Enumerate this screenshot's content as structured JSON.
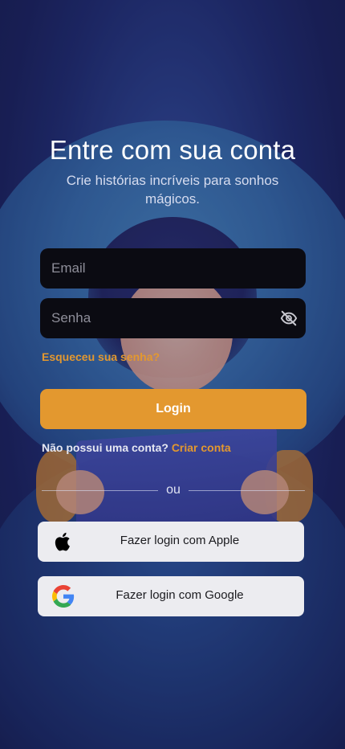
{
  "header": {
    "title": "Entre com sua conta",
    "subtitle": "Crie histórias incríveis para sonhos mágicos."
  },
  "form": {
    "email_placeholder": "Email",
    "email_value": "",
    "password_placeholder": "Senha",
    "password_value": "",
    "password_toggle_icon": "eye-off-icon",
    "forgot_label": "Esqueceu sua senha?",
    "login_label": "Login"
  },
  "signup": {
    "prompt": "Não possui uma conta?",
    "link_label": "Criar conta"
  },
  "divider": {
    "label": "ou"
  },
  "social": {
    "apple_label": "Fazer login com Apple",
    "apple_icon": "apple-icon",
    "google_label": "Fazer login com Google",
    "google_icon": "google-icon"
  },
  "colors": {
    "accent": "#e3982f",
    "field_bg": "#0b0b12",
    "social_bg": "#ececf0"
  }
}
